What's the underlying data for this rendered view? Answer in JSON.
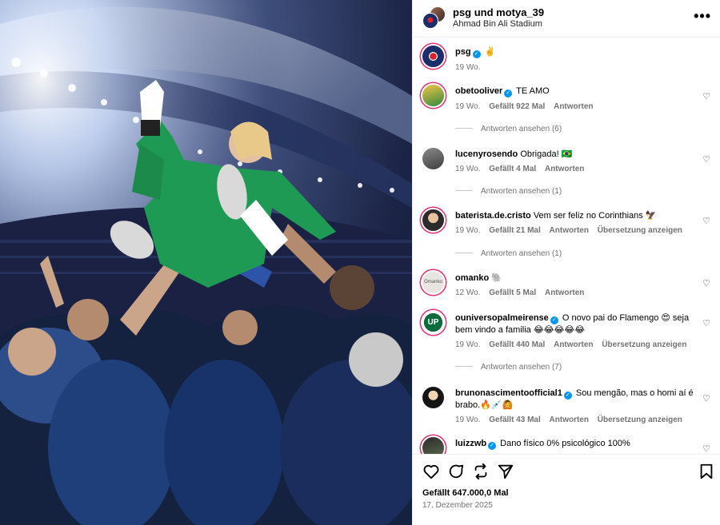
{
  "post": {
    "authors_line": "psg und motya_39",
    "location": "Ahmad Bin Ali Stadium",
    "caption_user": "psg",
    "caption_text": "✌️",
    "caption_age": "19 Wo."
  },
  "comments": [
    {
      "user": "obetooliver",
      "verified": true,
      "text": "TE AMO",
      "age": "19 Wo.",
      "likes": "Gefällt 922 Mal",
      "reply": "Antworten",
      "translate": "",
      "view_replies": "Antworten ansehen (6)"
    },
    {
      "user": "lucenyrosendo",
      "verified": false,
      "text": "Obrigada! 🇧🇷",
      "age": "19 Wo.",
      "likes": "Gefällt 4 Mal",
      "reply": "Antworten",
      "translate": "",
      "view_replies": "Antworten ansehen (1)"
    },
    {
      "user": "baterista.de.cristo",
      "verified": false,
      "text": "Vem ser feliz no Corinthians 🦅",
      "age": "19 Wo.",
      "likes": "Gefällt 21 Mal",
      "reply": "Antworten",
      "translate": "Übersetzung anzeigen",
      "view_replies": "Antworten ansehen (1)"
    },
    {
      "user": "omanko",
      "verified": false,
      "text": "🐘",
      "age": "12 Wo.",
      "likes": "Gefällt 5 Mal",
      "reply": "Antworten",
      "translate": "",
      "view_replies": ""
    },
    {
      "user": "ouniversopalmeirense",
      "verified": true,
      "text": "O novo pai do Flamengo 😍 seja bem vindo a familia 😂😂😂😂😂",
      "age": "19 Wo.",
      "likes": "Gefällt 440 Mal",
      "reply": "Antworten",
      "translate": "Übersetzung anzeigen",
      "view_replies": "Antworten ansehen (7)"
    },
    {
      "user": "brunonascimentoofficial1",
      "verified": true,
      "text": "Sou mengão, mas o homi aí é brabo.🔥💉🙆",
      "age": "19 Wo.",
      "likes": "Gefällt 43 Mal",
      "reply": "Antworten",
      "translate": "Übersetzung anzeigen",
      "view_replies": ""
    },
    {
      "user": "luizzwb",
      "verified": true,
      "text": "Dano físico 0% psicológico 100%",
      "age": "",
      "likes": "",
      "reply": "",
      "translate": "",
      "view_replies": ""
    }
  ],
  "omanko_avatar_text": "Omanko",
  "ouni_avatar_text": "UP",
  "verified_glyph": "✓",
  "heart_glyph": "♡",
  "more_glyph": "•••",
  "footer": {
    "likes": "Gefällt 647.000,0 Mal",
    "date": "17. Dezember 2025"
  },
  "icons": [
    "heart-icon",
    "comment-icon",
    "repost-icon",
    "share-icon",
    "bookmark-icon"
  ]
}
